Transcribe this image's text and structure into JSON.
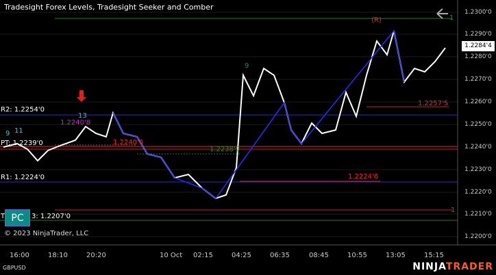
{
  "title": "Tradesight Forex Levels, Tradesight Seeker and Comber",
  "copyright": "© 2023 NinjaTrader, LLC",
  "symbol": "GBPUSD",
  "brand_a": "NINJA",
  "brand_b": "TRADER",
  "pc_label": "PC",
  "current_price": "1.2284'4",
  "price_ticks": [
    "1.2300'0",
    "1.2290'0",
    "1.2280'0",
    "1.2270'0",
    "1.2260'0",
    "1.2250'0",
    "1.2240'0",
    "1.2230'0",
    "1.2220'0",
    "1.2210'0",
    "1.2200'0"
  ],
  "time_ticks": [
    "16:00",
    "18:10",
    "20:20",
    "10 Oct",
    "02:15",
    "04:25",
    "06:35",
    "08:45",
    "10:55",
    "13:05",
    "15:15"
  ],
  "levels": {
    "r2": "R2: 1.2254'0",
    "pt": "PT: 1.2239'0",
    "r1": "R1: 1.2224'0",
    "pp_prefix": "T",
    "pp": "3: 1.2207'0"
  },
  "annotations": {
    "seeker_a": "1.2240'8",
    "seeker_b": "1.2240'0",
    "comber_mid": "1.2238'9",
    "red_mid": "1.2224'6",
    "red_right": "1.2257'5",
    "r_marker": "(R)",
    "green_top_count": "1",
    "red_bottom_count": "1",
    "count_13": "13",
    "count_9": "9",
    "count_11": "11",
    "count_9b": "9"
  },
  "colors": {
    "bg": "#000000",
    "up_bar": "#ffffff",
    "down_bar": "#2a2aff",
    "blue_level": "#2030c0",
    "red_level": "#cc2020",
    "green_level": "#208020",
    "accent": "#ff5a1f"
  },
  "icons": {
    "back": "back-arrow-icon",
    "down_arrow": "down-arrow-icon"
  }
}
